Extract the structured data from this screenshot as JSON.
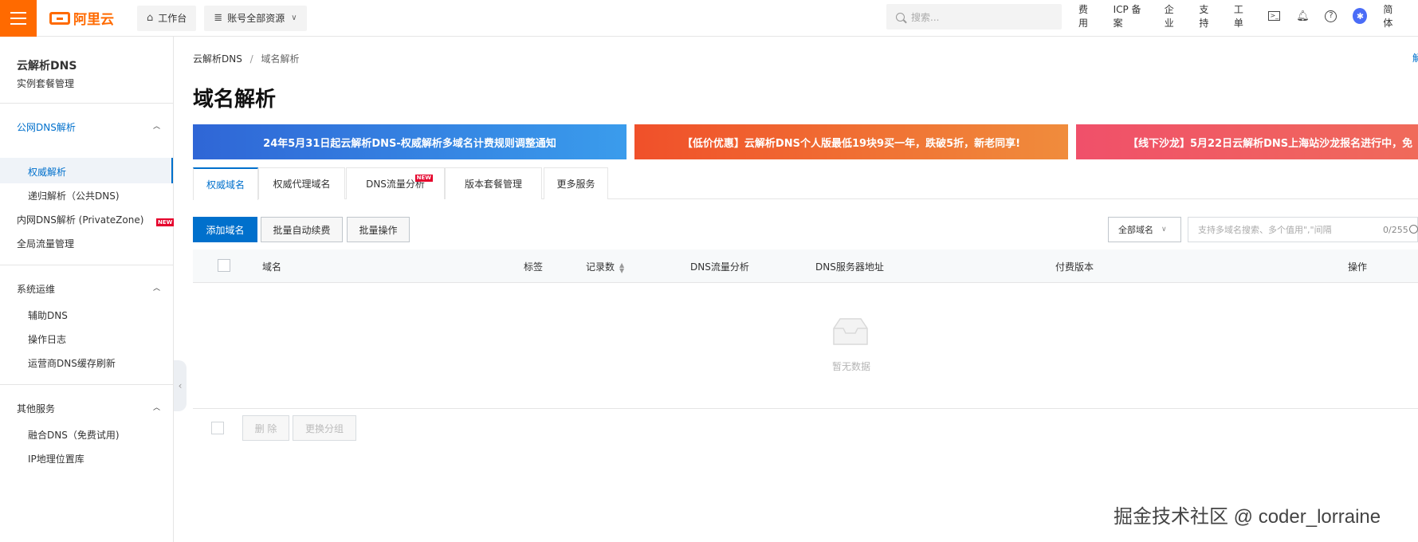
{
  "topbar": {
    "logo_text": "阿里云",
    "workbench_label": "工作台",
    "resources_label": "账号全部资源",
    "search_placeholder": "搜索...",
    "links": [
      "费用",
      "ICP 备案",
      "企业",
      "支持",
      "工单"
    ],
    "lang_label": "简体",
    "icons": [
      "terminal-icon",
      "bell-icon",
      "help-icon",
      "avatar"
    ]
  },
  "sidebar": {
    "title": "云解析DNS",
    "instance_label": "实例套餐管理",
    "groups": [
      {
        "label": "公网DNS解析",
        "items": [
          "权威解析",
          "递归解析（公共DNS)"
        ]
      },
      {
        "label": "内网DNS解析 (PrivateZone)",
        "items": []
      },
      {
        "label": "全局流量管理",
        "items": []
      },
      {
        "label": "系统运维",
        "items": [
          "辅助DNS",
          "操作日志",
          "运营商DNS缓存刷新"
        ]
      },
      {
        "label": "其他服务",
        "items": [
          "融合DNS（免费试用)",
          "IP地理位置库"
        ]
      }
    ],
    "new_tag": "NEW"
  },
  "breadcrumb": {
    "root": "云解析DNS",
    "separator": "/",
    "current": "域名解析"
  },
  "page_title": "域名解析",
  "right_edge_link": "解",
  "banners": [
    "24年5月31日起云解析DNS-权威解析多域名计费规则调整通知",
    "【低价优惠】云解析DNS个人版最低19块9买一年，跌破5折，新老同享!",
    "【线下沙龙】5月22日云解析DNS上海站沙龙报名进行中，免"
  ],
  "tabs": [
    "权威域名",
    "权威代理域名",
    "DNS流量分析",
    "版本套餐管理",
    "更多服务"
  ],
  "tab_new_tag": "NEW",
  "actions": {
    "add_domain": "添加域名",
    "batch_renew": "批量自动续费",
    "batch_ops": "批量操作",
    "filter_select": "全部域名",
    "search_placeholder": "支持多域名搜索、多个值用\",\"间隔",
    "search_count": "0/255"
  },
  "table": {
    "columns": [
      "域名",
      "标签",
      "记录数",
      "DNS流量分析",
      "DNS服务器地址",
      "付费版本",
      "操作"
    ],
    "empty_text": "暂无数据"
  },
  "footer_actions": {
    "delete": "删 除",
    "change_group": "更换分组"
  },
  "watermark": "掘金技术社区 @ coder_lorraine",
  "colors": {
    "brand_orange": "#ff6a00",
    "primary_blue": "#0070cc",
    "new_red": "#e5002b"
  }
}
